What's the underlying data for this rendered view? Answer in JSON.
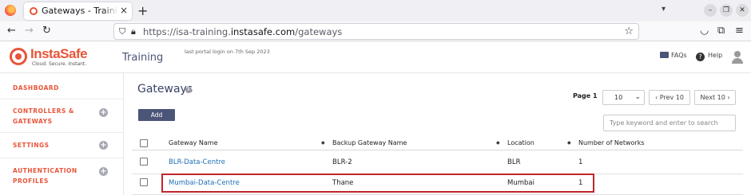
{
  "browser": {
    "tab_title": "Gateways - Training | InstaSafe",
    "tab_close": "×",
    "new_tab": "+",
    "url_prefix": "https://isa-training.",
    "url_domain": "instasafe.com",
    "url_path": "/gateways"
  },
  "header": {
    "logo_name": "InstaSafe",
    "logo_tagline": "Cloud. Secure. Instant.",
    "portal_name": "Training",
    "last_login": "last portal login on 7th Sep 2023",
    "faqs_label": "FAQs",
    "help_label": "Help"
  },
  "sidebar": {
    "items": [
      {
        "label": "DASHBOARD",
        "has_plus": false
      },
      {
        "label": "CONTROLLERS & GATEWAYS",
        "has_plus": true
      },
      {
        "label": "SETTINGS",
        "has_plus": true
      },
      {
        "label": "AUTHENTICATION PROFILES",
        "has_plus": true
      }
    ],
    "plus_glyph": "+"
  },
  "main": {
    "title": "Gateways",
    "info_glyph": "i",
    "add_label": "Add",
    "page_label": "Page 1",
    "per_page_value": "10",
    "prev_label": "‹ Prev 10",
    "next_label": "Next 10 ›",
    "search_placeholder": "Type keyword and enter to search"
  },
  "table": {
    "columns": [
      "Gateway Name",
      "Backup Gateway Name",
      "Location",
      "Number of Networks"
    ],
    "sort_glyph": "◆",
    "rows": [
      {
        "name": "BLR-Data-Centre",
        "backup": "BLR-2",
        "location": "BLR",
        "networks": "1"
      },
      {
        "name": "Mumbai-Data-Centre",
        "backup": "Thane",
        "location": "Mumbai",
        "networks": "1"
      }
    ]
  },
  "colors": {
    "brand_orange": "#e8553a",
    "nav_blue": "#4a5578",
    "link_blue": "#1f6fb5",
    "highlight_red": "#c0262d"
  }
}
